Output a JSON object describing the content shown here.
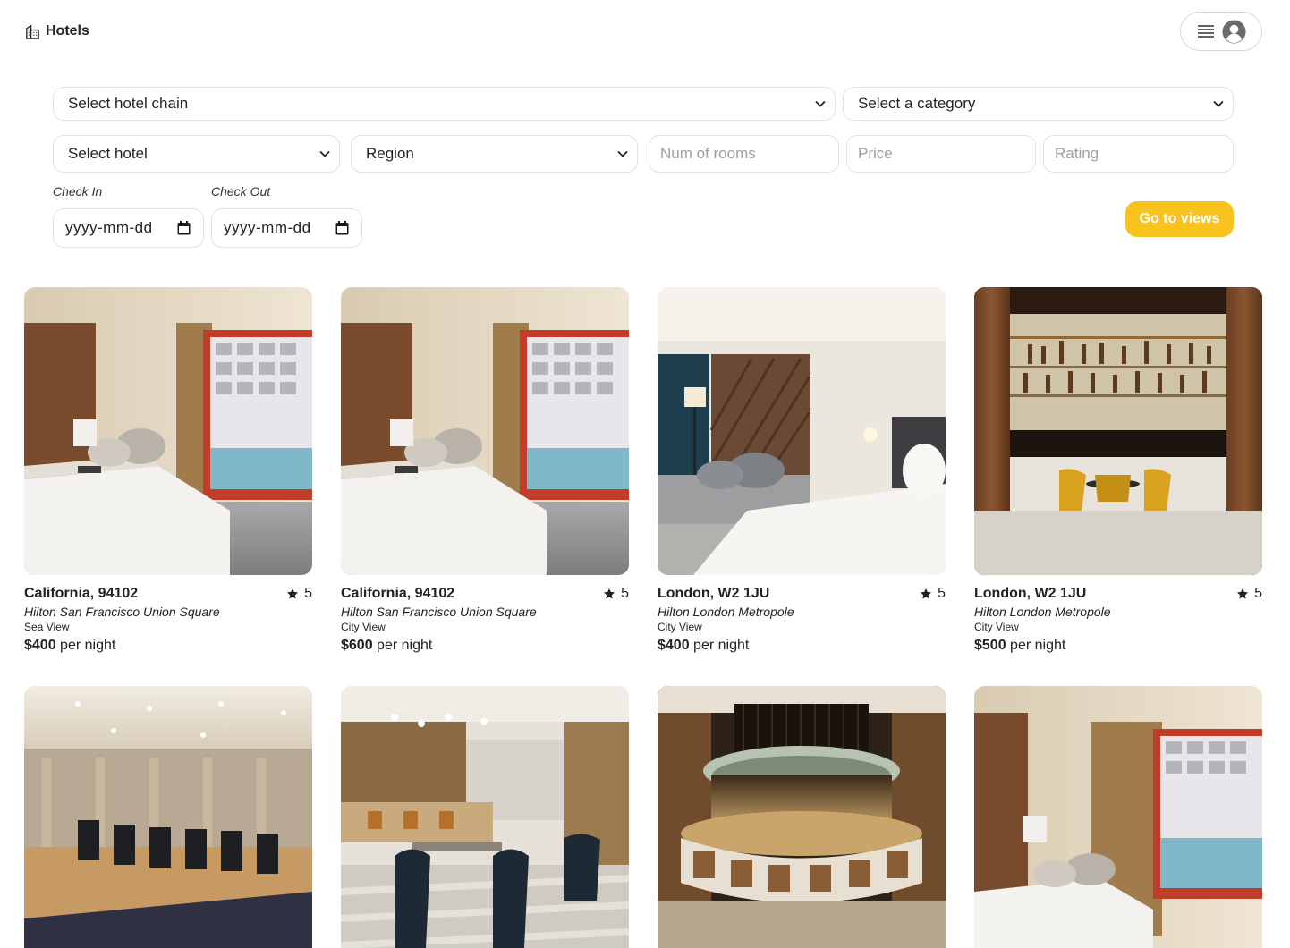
{
  "brand": {
    "name": "Hotels",
    "icon": "hotel-building-icon"
  },
  "user_menu": {
    "menu_icon": "hamburger-menu-icon",
    "avatar_icon": "user-avatar-icon"
  },
  "filters": {
    "hotel_chain": "Select hotel chain",
    "category": "Select a category",
    "hotel": "Select hotel",
    "region": "Region",
    "num_rooms_placeholder": "Num of rooms",
    "price_placeholder": "Price",
    "rating_placeholder": "Rating",
    "check_in_label": "Check In",
    "check_out_label": "Check Out",
    "check_in_value": "yyyy-mm-dd",
    "check_out_value": "yyyy-mm-dd",
    "go_button": "Go to views"
  },
  "colors": {
    "accent": "#f8c21f",
    "border": "#dee2e6",
    "text": "#222222"
  },
  "cards": [
    {
      "location": "California, 94102",
      "rating": "5",
      "hotel": "Hilton San Francisco Union Square",
      "category": "Sea View",
      "price": "$400",
      "price_suffix": "per night",
      "image": "hotel-room-pool-view"
    },
    {
      "location": "California, 94102",
      "rating": "5",
      "hotel": "Hilton San Francisco Union Square",
      "category": "City View",
      "price": "$600",
      "price_suffix": "per night",
      "image": "hotel-room-pool-view"
    },
    {
      "location": "London, W2 1JU",
      "rating": "5",
      "hotel": "Hilton London Metropole",
      "category": "City View",
      "price": "$400",
      "price_suffix": "per night",
      "image": "hotel-room-sofa"
    },
    {
      "location": "London, W2 1JU",
      "rating": "5",
      "hotel": "Hilton London Metropole",
      "category": "City View",
      "price": "$500",
      "price_suffix": "per night",
      "image": "hotel-bar"
    },
    {
      "image": "hotel-gym"
    },
    {
      "image": "hotel-cafe"
    },
    {
      "image": "hotel-round-bar"
    },
    {
      "image": "hotel-room-pool-view"
    }
  ]
}
